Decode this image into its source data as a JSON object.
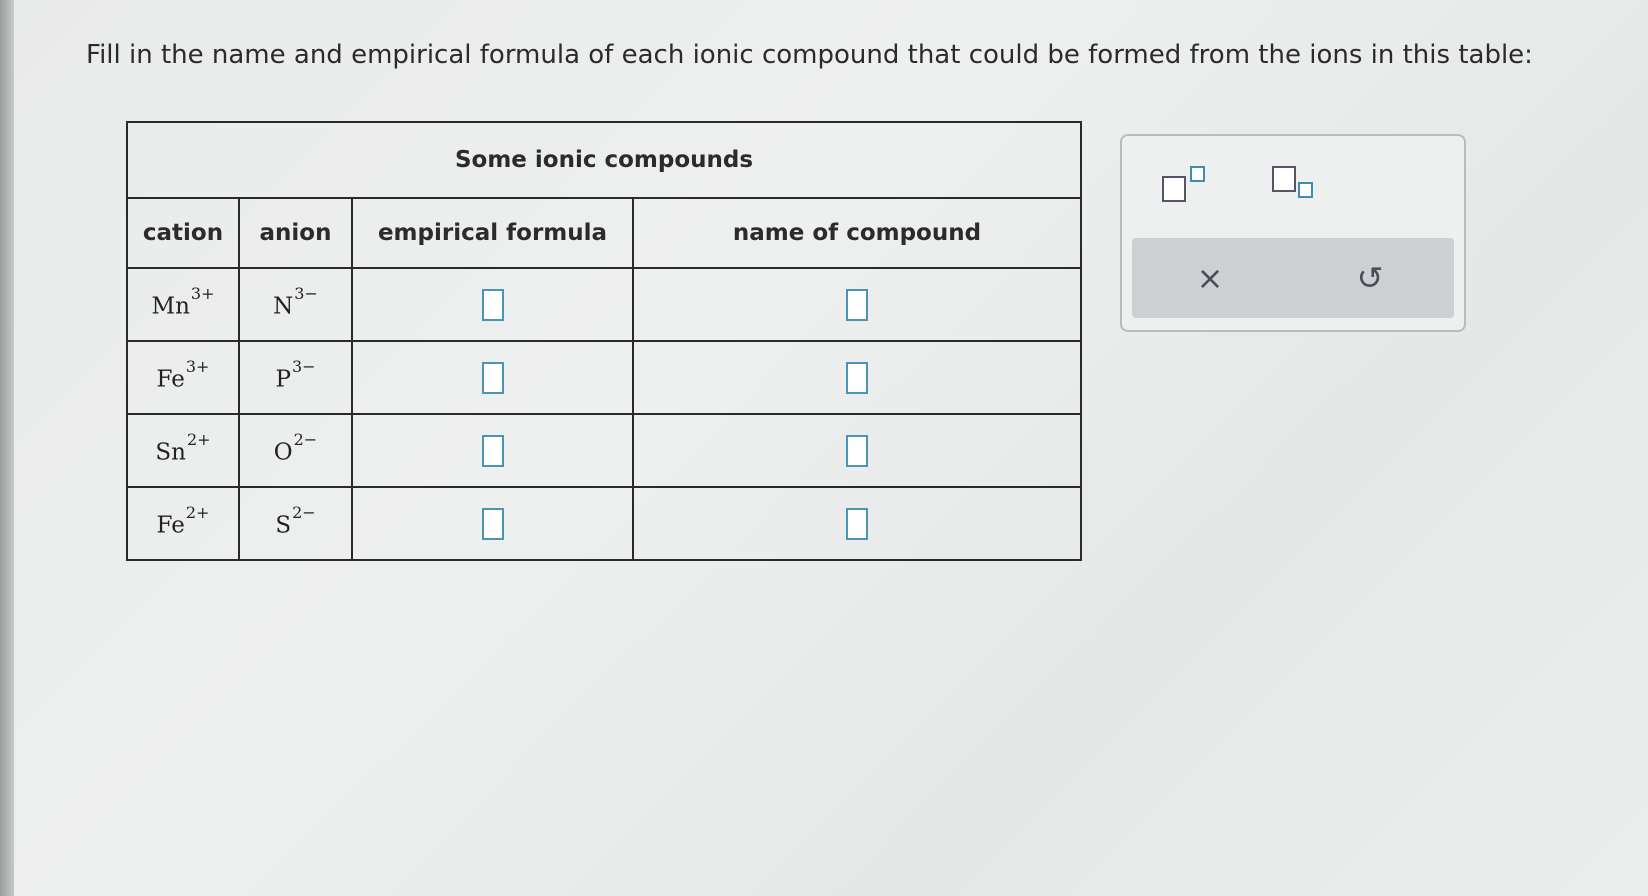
{
  "prompt": "Fill in the name and empirical formula of each ionic compound that could be formed from the ions in this table:",
  "table": {
    "caption": "Some ionic compounds",
    "headers": [
      "cation",
      "anion",
      "empirical formula",
      "name of compound"
    ],
    "rows": [
      {
        "cation": "Mn",
        "cation_charge": "3+",
        "anion": "N",
        "anion_charge": "3−"
      },
      {
        "cation": "Fe",
        "cation_charge": "3+",
        "anion": "P",
        "anion_charge": "3−"
      },
      {
        "cation": "Sn",
        "cation_charge": "2+",
        "anion": "O",
        "anion_charge": "2−"
      },
      {
        "cation": "Fe",
        "cation_charge": "2+",
        "anion": "S",
        "anion_charge": "2−"
      }
    ]
  },
  "toolbar": {
    "superscript_icon": "superscript-icon",
    "subscript_icon": "subscript-icon",
    "clear_symbol": "×",
    "undo_symbol": "↺"
  },
  "colors": {
    "answer_box_border": "#4a94b8",
    "action_bar": "#cdd0d2"
  }
}
